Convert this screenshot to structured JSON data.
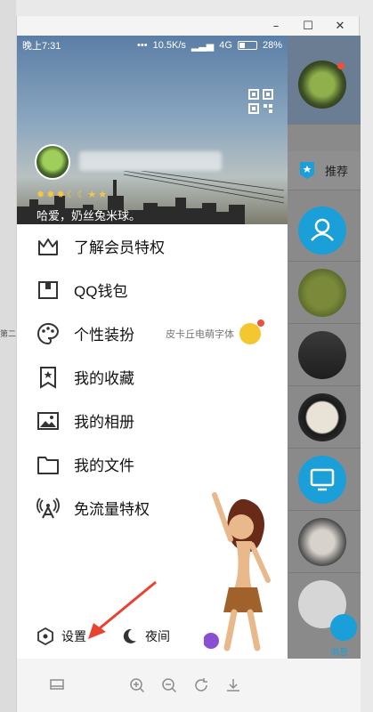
{
  "window": {
    "minimize_glyph": "–",
    "maximize_glyph": "☐",
    "close_glyph": "✕"
  },
  "status_bar": {
    "time": "晚上7:31",
    "speed": "10.5K/s",
    "network": "4G",
    "battery": "28%"
  },
  "profile": {
    "signature": "哈爱，奶丝兔米球。",
    "level_icons": [
      "sun-icon",
      "sun-icon",
      "sun-icon",
      "moon-icon",
      "moon-icon",
      "star-icon",
      "star-icon"
    ]
  },
  "menu": [
    {
      "id": "vip",
      "label": "了解会员特权",
      "icon": "crown-icon"
    },
    {
      "id": "wallet",
      "label": "QQ钱包",
      "icon": "wallet-icon"
    },
    {
      "id": "dressup",
      "label": "个性装扮",
      "icon": "palette-icon",
      "extra": "皮卡丘电萌字体"
    },
    {
      "id": "favorites",
      "label": "我的收藏",
      "icon": "bookmark-star-icon"
    },
    {
      "id": "album",
      "label": "我的相册",
      "icon": "photo-icon"
    },
    {
      "id": "files",
      "label": "我的文件",
      "icon": "folder-icon"
    },
    {
      "id": "freedata",
      "label": "免流量特权",
      "icon": "antenna-icon"
    }
  ],
  "bottom": {
    "settings_label": "设置",
    "night_label": "夜间"
  },
  "right_panel": {
    "recommend_label": "推荐",
    "message_label": "消息"
  },
  "left_fragments": [
    {
      "text": "第二"
    }
  ],
  "colors": {
    "accent_blue": "#1a9fd9",
    "arrow_red": "#e8432f",
    "icon_gray": "#333333"
  }
}
